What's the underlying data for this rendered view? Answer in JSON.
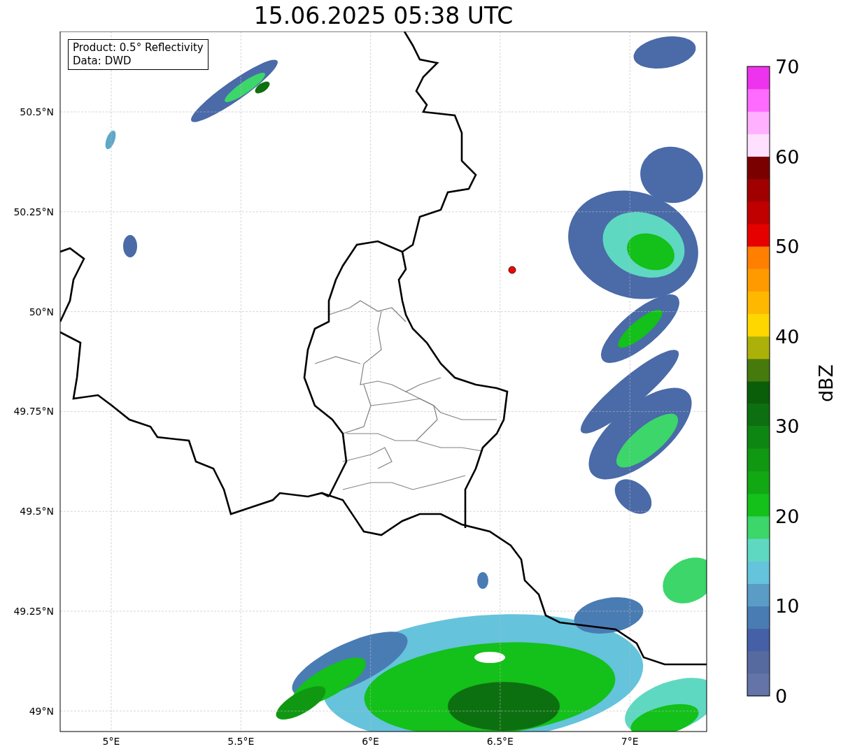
{
  "title": "15.06.2025 05:38 UTC",
  "info_box": {
    "lines": [
      "Product: 0.5° Reflectivity",
      "Data: DWD"
    ]
  },
  "map": {
    "x_ticks": [
      "5°E",
      "5.5°E",
      "6°E",
      "6.5°E",
      "7°E"
    ],
    "y_ticks": [
      "50.5°N",
      "50.25°N",
      "50°N",
      "49.75°N",
      "49.5°N",
      "49.25°N",
      "49°N"
    ]
  },
  "colorbar": {
    "label": "dBZ",
    "ticks": [
      "70",
      "60",
      "50",
      "40",
      "30",
      "20",
      "10",
      "0"
    ],
    "bins": [
      {
        "color": "#6474a8"
      },
      {
        "color": "#566aa0"
      },
      {
        "color": "#4560a6"
      },
      {
        "color": "#4a7cb4"
      },
      {
        "color": "#5a9cc6"
      },
      {
        "color": "#65c3dc"
      },
      {
        "color": "#5fd8c2"
      },
      {
        "color": "#3cd66a"
      },
      {
        "color": "#14c01a"
      },
      {
        "color": "#12a814"
      },
      {
        "color": "#109813"
      },
      {
        "color": "#0e8612"
      },
      {
        "color": "#0d7010"
      },
      {
        "color": "#0a5e0a"
      },
      {
        "color": "#477a0c"
      },
      {
        "color": "#acb10a"
      },
      {
        "color": "#ffd700"
      },
      {
        "color": "#ffb800"
      },
      {
        "color": "#ff9a00"
      },
      {
        "color": "#ff7f00"
      },
      {
        "color": "#e60000"
      },
      {
        "color": "#c00000"
      },
      {
        "color": "#a00000"
      },
      {
        "color": "#7a0000"
      },
      {
        "color": "#ffe0ff"
      },
      {
        "color": "#ffb0ff"
      },
      {
        "color": "#ff6aff"
      },
      {
        "color": "#ee33ee"
      }
    ]
  }
}
